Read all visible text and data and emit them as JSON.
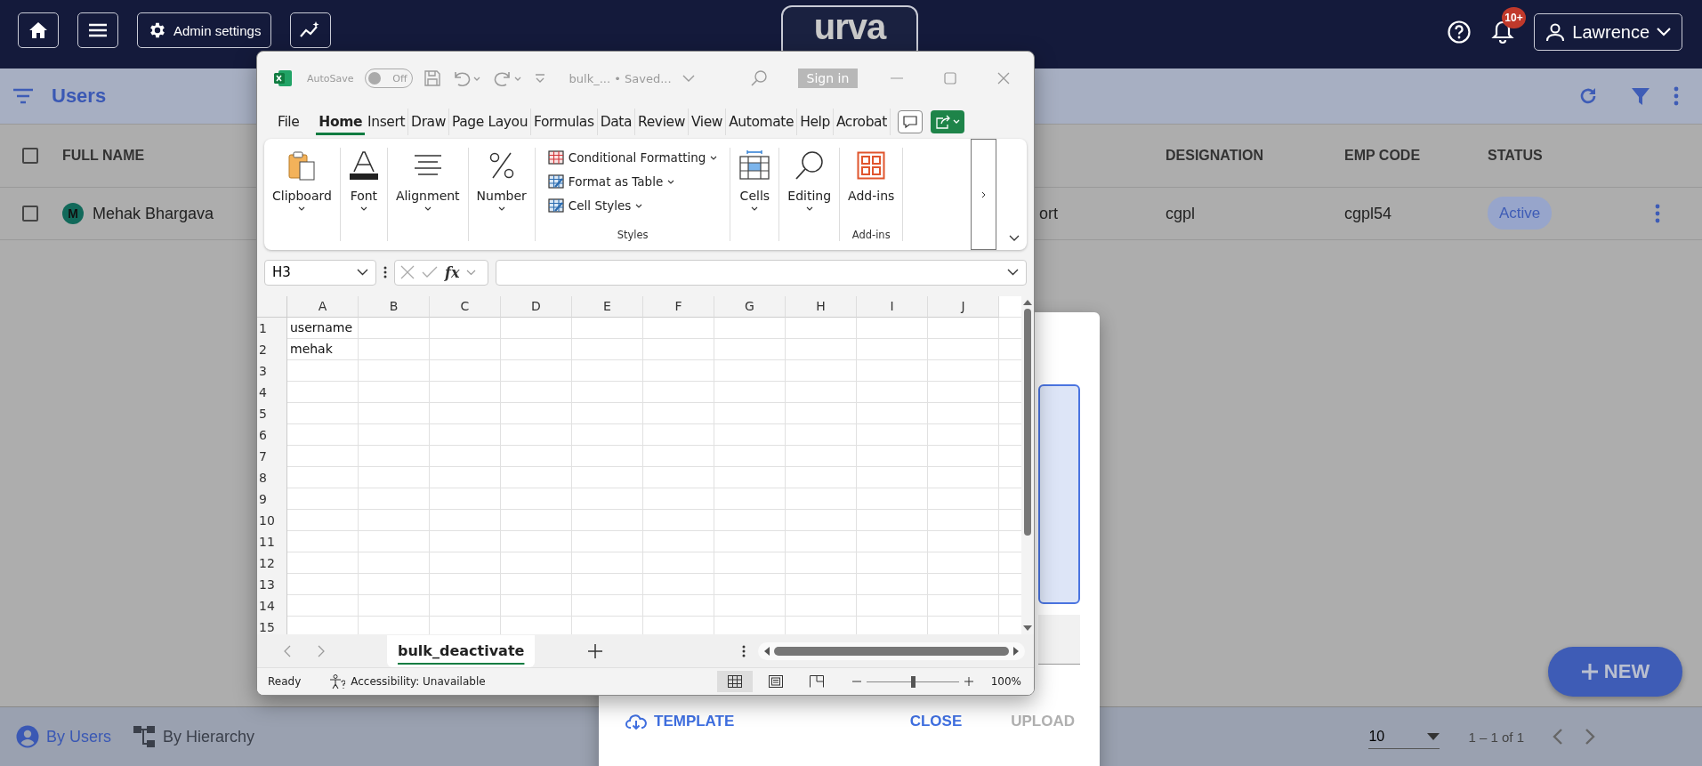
{
  "navbar": {
    "admin_settings": "Admin settings",
    "logo": "urva",
    "notification_badge": "10+",
    "user_name": "Lawrence"
  },
  "page": {
    "title": "Users",
    "table": {
      "header_checked": false,
      "columns": [
        "FULL NAME",
        "DESIGNATION",
        "EMP CODE",
        "STATUS"
      ],
      "rows": [
        {
          "checked": false,
          "avatar": "M",
          "full_name": "Mehak Bhargava",
          "column_3": "ort",
          "designation": "cgpl",
          "emp_code": "cgpl54",
          "status": "Active"
        }
      ]
    }
  },
  "new_button": "NEW",
  "bottom_bar": {
    "views": [
      {
        "label": "By Users",
        "selected": true
      },
      {
        "label": "By Hierarchy",
        "selected": false
      }
    ],
    "page_size": "10",
    "range": "1 – 1 of 1"
  },
  "dialog": {
    "buttons": [
      {
        "label": "TEMPLATE",
        "kind": "template",
        "disabled": false
      },
      {
        "label": "CLOSE",
        "kind": "text",
        "disabled": false
      },
      {
        "label": "UPLOAD",
        "kind": "text",
        "disabled": true
      }
    ]
  },
  "excel": {
    "autosave": {
      "label": "AutoSave",
      "on": false,
      "state": "Off"
    },
    "file_title": "bulk_... • Saved...",
    "sign_in": "Sign in",
    "tabs": [
      {
        "label": "File",
        "selected": false
      },
      {
        "label": "Home",
        "selected": true
      },
      {
        "label": "Insert",
        "selected": false
      },
      {
        "label": "Draw",
        "selected": false
      },
      {
        "label": "Page Layou",
        "selected": false
      },
      {
        "label": "Formulas",
        "selected": false
      },
      {
        "label": "Data",
        "selected": false
      },
      {
        "label": "Review",
        "selected": false
      },
      {
        "label": "View",
        "selected": false
      },
      {
        "label": "Automate",
        "selected": false
      },
      {
        "label": "Help",
        "selected": false
      },
      {
        "label": "Acrobat",
        "selected": false
      }
    ],
    "ribbon_groups": [
      {
        "kind": "clipboard",
        "label": "Clipboard"
      },
      {
        "kind": "font",
        "label": "Font"
      },
      {
        "kind": "alignment",
        "label": "Alignment"
      },
      {
        "kind": "number",
        "label": "Number"
      },
      {
        "kind": "styles",
        "label": "Styles",
        "items": [
          "Conditional Formatting",
          "Format as Table",
          "Cell Styles"
        ]
      },
      {
        "kind": "cells",
        "label": "Cells"
      },
      {
        "kind": "editing",
        "label": "Editing"
      },
      {
        "kind": "addins",
        "label": "Add-ins",
        "group_label": "Add-ins"
      }
    ],
    "name_box": "H3",
    "function_label": "fx",
    "columns": [
      "A",
      "B",
      "C",
      "D",
      "E",
      "F",
      "G",
      "H",
      "I",
      "J"
    ],
    "rows": [
      {
        "number": "1",
        "cells": {
          "A": "username"
        }
      },
      {
        "number": "2",
        "cells": {
          "A": "mehak"
        }
      },
      {
        "number": "3",
        "cells": {}
      },
      {
        "number": "4",
        "cells": {}
      },
      {
        "number": "5",
        "cells": {}
      },
      {
        "number": "6",
        "cells": {}
      },
      {
        "number": "7",
        "cells": {}
      },
      {
        "number": "8",
        "cells": {}
      },
      {
        "number": "9",
        "cells": {}
      },
      {
        "number": "10",
        "cells": {}
      },
      {
        "number": "11",
        "cells": {}
      },
      {
        "number": "12",
        "cells": {}
      },
      {
        "number": "13",
        "cells": {}
      },
      {
        "number": "14",
        "cells": {}
      },
      {
        "number": "15",
        "cells": {}
      }
    ],
    "sheet_tabs": [
      {
        "label": "bulk_deactivate",
        "selected": true
      }
    ],
    "status": "Ready",
    "accessibility": "Accessibility: Unavailable",
    "views": [
      {
        "kind": "normal",
        "selected": true
      },
      {
        "kind": "page_layout",
        "selected": false
      },
      {
        "kind": "page_break",
        "selected": false
      }
    ],
    "zoom": {
      "level": 0.5,
      "text": "100%"
    }
  }
}
